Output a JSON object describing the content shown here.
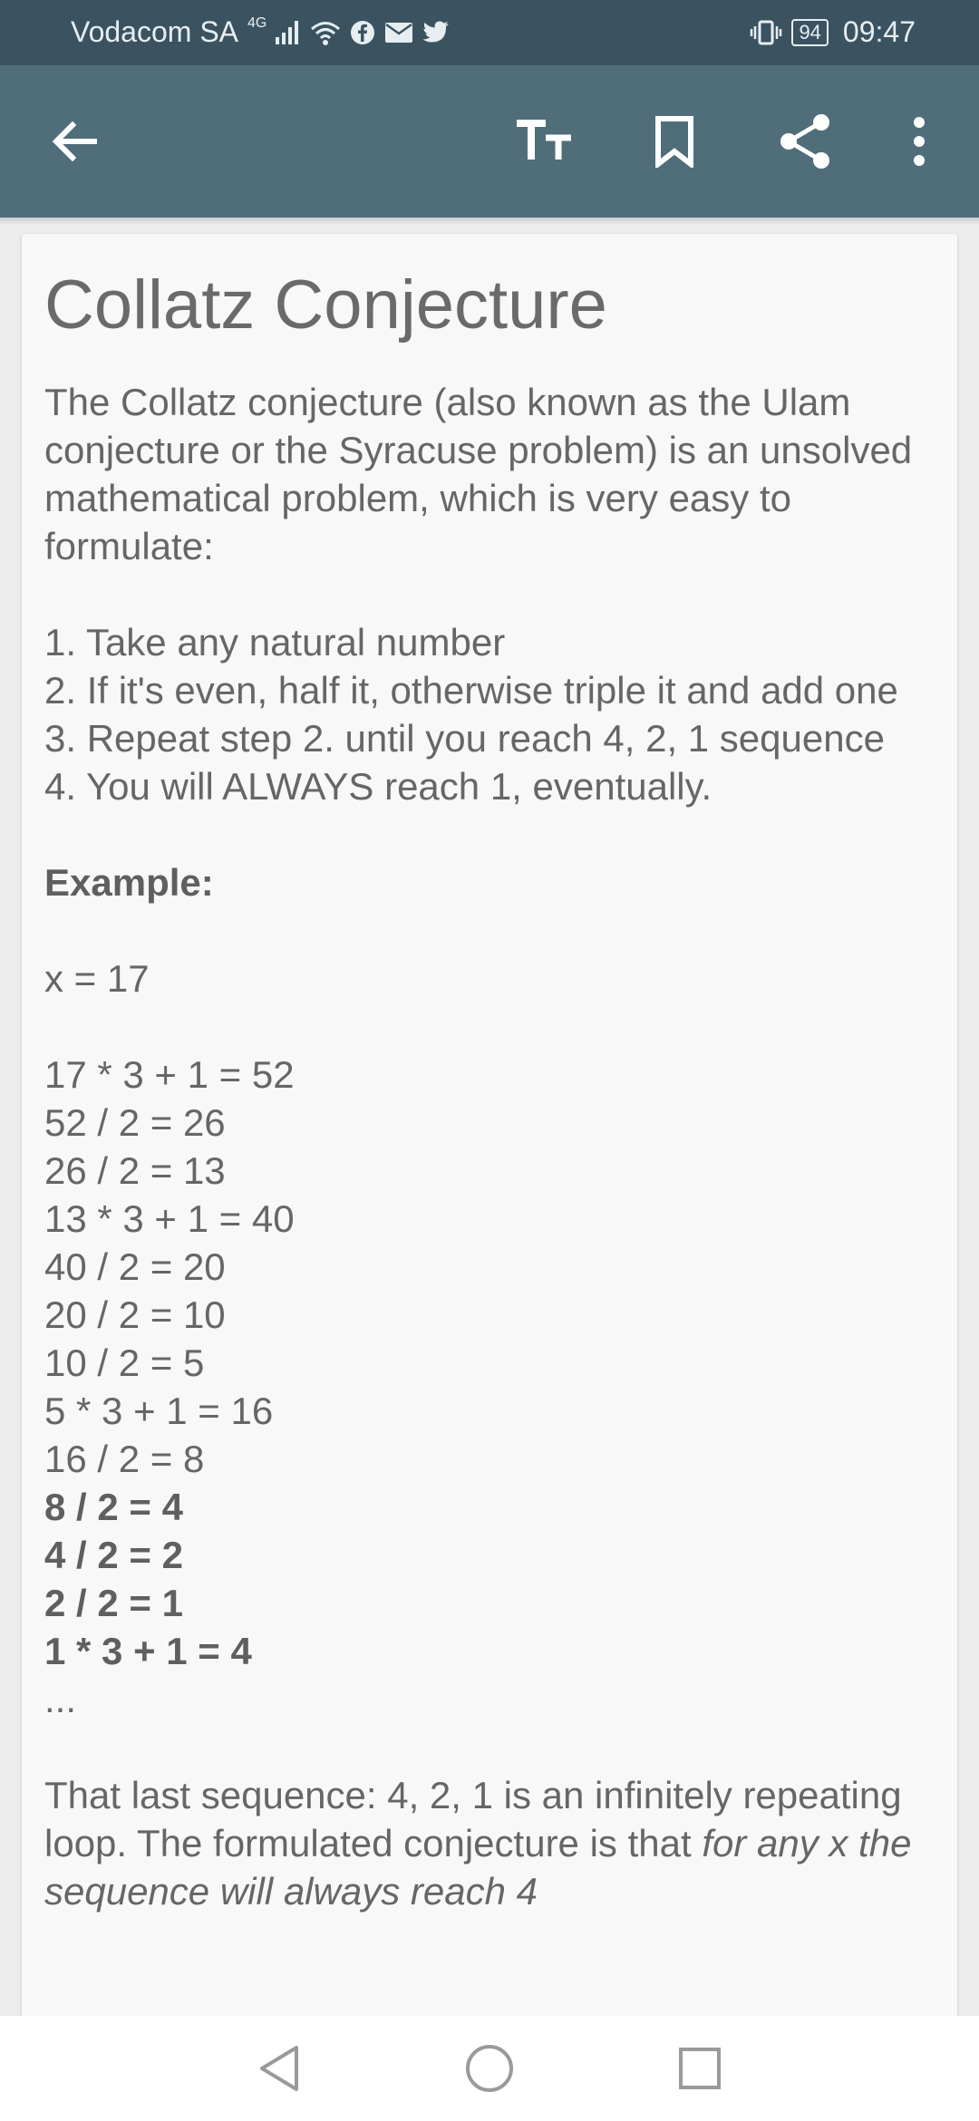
{
  "status_bar": {
    "carrier": "Vodacom SA",
    "network": "4G",
    "battery": "94",
    "time": "09:47",
    "icons": [
      "signal-icon",
      "wifi-icon",
      "facebook-icon",
      "mail-icon",
      "twitter-icon",
      "vibrate-icon"
    ]
  },
  "toolbar": {
    "icons": [
      "back-arrow-icon",
      "text-size-icon",
      "bookmark-icon",
      "share-icon",
      "more-vert-icon"
    ]
  },
  "article": {
    "title": "Collatz Conjecture",
    "intro": "The Collatz conjecture (also known as the Ulam conjecture or the Syracuse problem) is an unsolved mathematical problem, which is very easy to formulate:",
    "steps": [
      "1. Take any natural number",
      "2. If it's even, half it, otherwise triple it and add one",
      "3. Repeat step 2. until you reach 4, 2, 1 sequence",
      "4. You will ALWAYS reach 1, eventually."
    ],
    "example_label": "Example:",
    "x_line": "x = 17",
    "calc_lines": [
      "17 * 3 + 1 = 52",
      "52 / 2 = 26",
      "26 / 2 = 13",
      "13 * 3 + 1 = 40",
      "40 / 2 = 20",
      "20 / 2 = 10",
      "10 / 2 = 5",
      "5 * 3 + 1 = 16",
      "16 / 2 = 8"
    ],
    "bold_lines": [
      "8 / 2 = 4",
      "4 / 2 = 2",
      "2 / 2 = 1",
      "1 * 3 + 1 = 4"
    ],
    "ellipsis": "...",
    "conclusion_start": "That last sequence: 4, 2, 1 is an infinitely repeating loop. The formulated conjecture is that ",
    "conclusion_italic": "for any x the sequence will always reach 4"
  },
  "nav_bar": {
    "icons": [
      "back-triangle-icon",
      "home-circle-icon",
      "recents-square-icon"
    ]
  },
  "colors": {
    "status_bar": "#3b5360",
    "app_bar": "#506d7a",
    "card": "#f8f8f8",
    "text": "#666666"
  }
}
